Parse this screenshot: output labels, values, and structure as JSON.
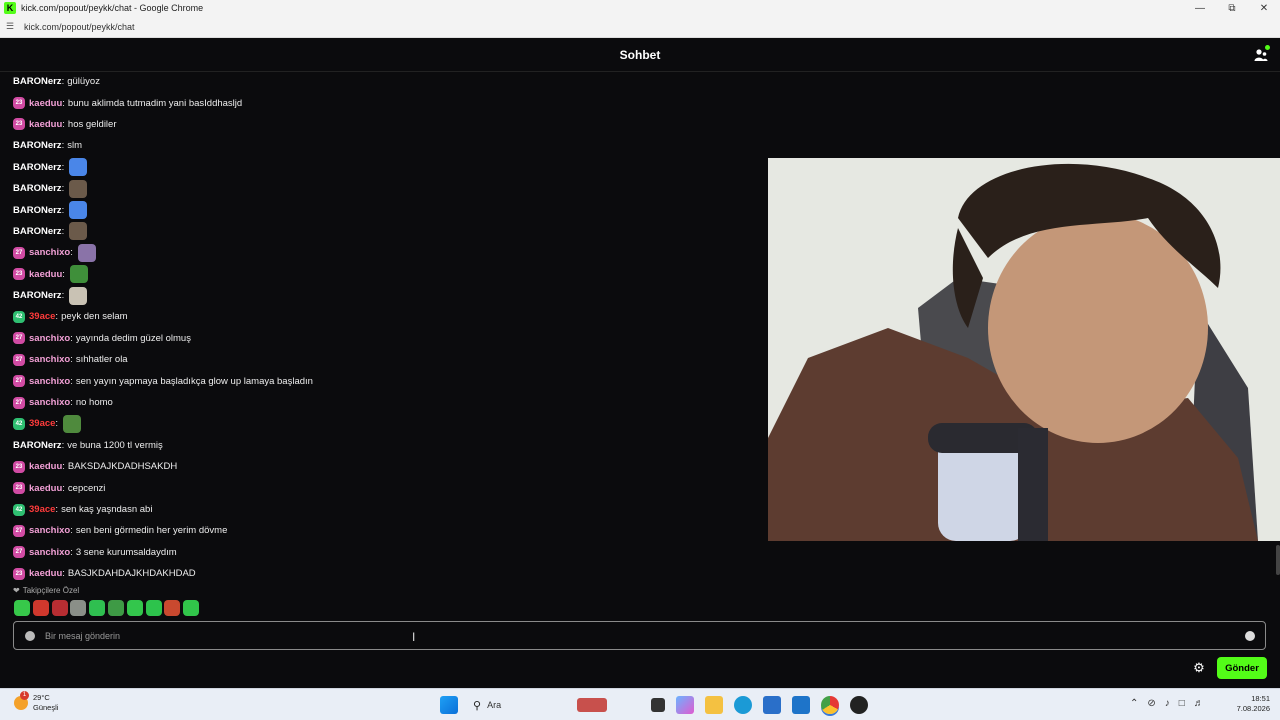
{
  "browser": {
    "window_title": "kick.com/popout/peykk/chat - Google Chrome",
    "url": "kick.com/popout/peykk/chat",
    "favicon_letter": "K"
  },
  "chat": {
    "title": "Sohbet",
    "messages": [
      {
        "user": "BARONerz",
        "text": "gülüyoz",
        "badge": "",
        "color": "#ffffff"
      },
      {
        "user": "kaeduu",
        "text": "bunu aklimda tutmadim yani basIddhasljd",
        "badge": "23",
        "color": "#f2a0d6"
      },
      {
        "user": "kaeduu",
        "text": "hos geldiler",
        "badge": "23",
        "color": "#f2a0d6"
      },
      {
        "user": "BARONerz",
        "text": "slm",
        "badge": "",
        "color": "#ffffff"
      },
      {
        "user": "BARONerz",
        "text": "",
        "badge": "",
        "color": "#ffffff",
        "emote": "blue-feather-emote"
      },
      {
        "user": "BARONerz",
        "text": "",
        "badge": "",
        "color": "#ffffff",
        "emote": "dancer-emote"
      },
      {
        "user": "BARONerz",
        "text": "",
        "badge": "",
        "color": "#ffffff",
        "emote": "blue-feather-emote"
      },
      {
        "user": "BARONerz",
        "text": "",
        "badge": "",
        "color": "#ffffff",
        "emote": "dancer-emote"
      },
      {
        "user": "sanchixo",
        "text": "",
        "badge": "27",
        "color": "#f2a0d6",
        "emote": "purple-creature-emote"
      },
      {
        "user": "kaeduu",
        "text": "",
        "badge": "23",
        "color": "#f2a0d6",
        "emote": "pepe-emote"
      },
      {
        "user": "BARONerz",
        "text": "",
        "badge": "",
        "color": "#ffffff",
        "emote": "cat-emote"
      },
      {
        "user": "39ace",
        "text": "peyk den selam",
        "badge": "42",
        "color": "#ff3b3b"
      },
      {
        "user": "sanchixo",
        "text": "yayında dedim güzel olmuş",
        "badge": "27",
        "color": "#f2a0d6"
      },
      {
        "user": "sanchixo",
        "text": "sıhhatler ola",
        "badge": "27",
        "color": "#f2a0d6"
      },
      {
        "user": "sanchixo",
        "text": "sen yayın yapmaya başladıkça glow up lamaya başladın",
        "badge": "27",
        "color": "#f2a0d6"
      },
      {
        "user": "sanchixo",
        "text": "no homo",
        "badge": "27",
        "color": "#f2a0d6"
      },
      {
        "user": "39ace",
        "text": "",
        "badge": "42",
        "color": "#ff3b3b",
        "emote": "pepe-lying-emote"
      },
      {
        "user": "BARONerz",
        "text": "ve buna 1200 tl vermiş",
        "badge": "",
        "color": "#ffffff"
      },
      {
        "user": "kaeduu",
        "text": "BAKSDAJKDADHSAKDH",
        "badge": "23",
        "color": "#f2a0d6"
      },
      {
        "user": "kaeduu",
        "text": "cepcenzi",
        "badge": "23",
        "color": "#f2a0d6"
      },
      {
        "user": "39ace",
        "text": "sen kaş yaşndasn abi",
        "badge": "42",
        "color": "#ff3b3b"
      },
      {
        "user": "sanchixo",
        "text": "sen beni görmedin her yerim dövme",
        "badge": "27",
        "color": "#f2a0d6"
      },
      {
        "user": "sanchixo",
        "text": "3 sene kurumsaldaydım",
        "badge": "27",
        "color": "#f2a0d6"
      },
      {
        "user": "kaeduu",
        "text": "BASJKDAHDAJKHDAKHDAD",
        "badge": "23",
        "color": "#f2a0d6"
      }
    ],
    "followers_label": "Takipçilere Özel",
    "input_placeholder": "Bir mesaj gönderin",
    "send_label": "Gönder"
  },
  "taskbar": {
    "weather_temp": "29°C",
    "weather_desc": "Güneşli",
    "weather_badge": "1",
    "search_label": "Ara",
    "time": "18:51",
    "date": "7.08.2026"
  },
  "colors": {
    "accent": "#53fc18",
    "badge_pink": "#d14ba3",
    "badge_green": "#2fbf71",
    "background": "#0b0b0d"
  }
}
